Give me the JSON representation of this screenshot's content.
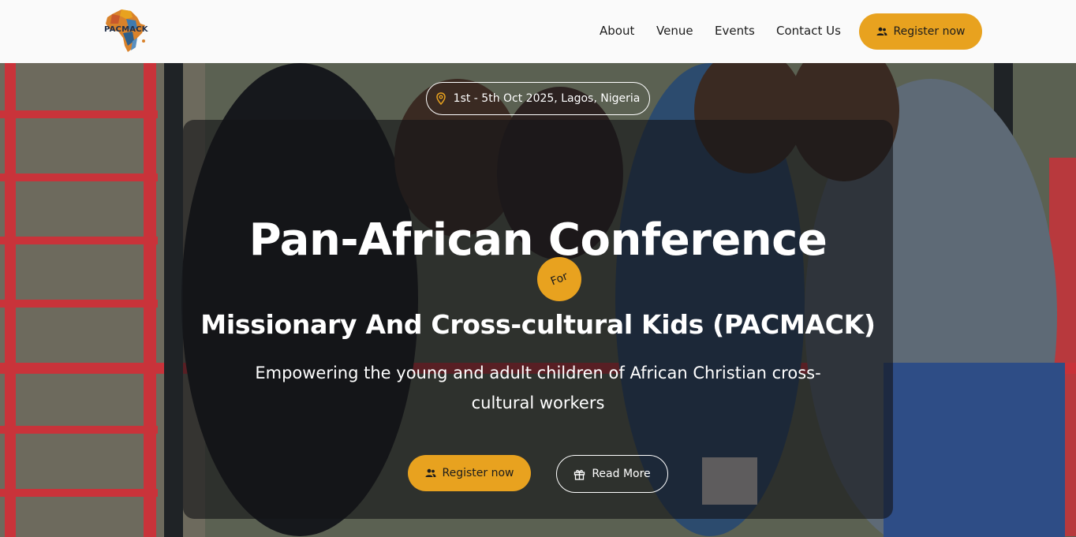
{
  "header": {
    "logo_text": "PACMACK",
    "nav": {
      "about": "About",
      "venue": "Venue",
      "events": "Events",
      "contact": "Contact Us"
    },
    "register_label": "Register now",
    "register_icon": "users-icon"
  },
  "hero": {
    "date_location": "1st - 5th Oct 2025, Lagos, Nigeria",
    "date_icon": "map-pin-icon",
    "title": "Pan-African Conference",
    "for_badge": "For",
    "subtitle": "Missionary And Cross-cultural Kids (PACMACK)",
    "tagline": "Empowering the young and adult children of African Christian cross-cultural workers",
    "register_label": "Register now",
    "read_more_label": "Read More",
    "read_more_icon": "gift-icon"
  },
  "colors": {
    "accent": "#e8a21f",
    "header_bg": "#fafafa",
    "text_dark": "#1c1c1c",
    "text_light": "#ffffff"
  }
}
